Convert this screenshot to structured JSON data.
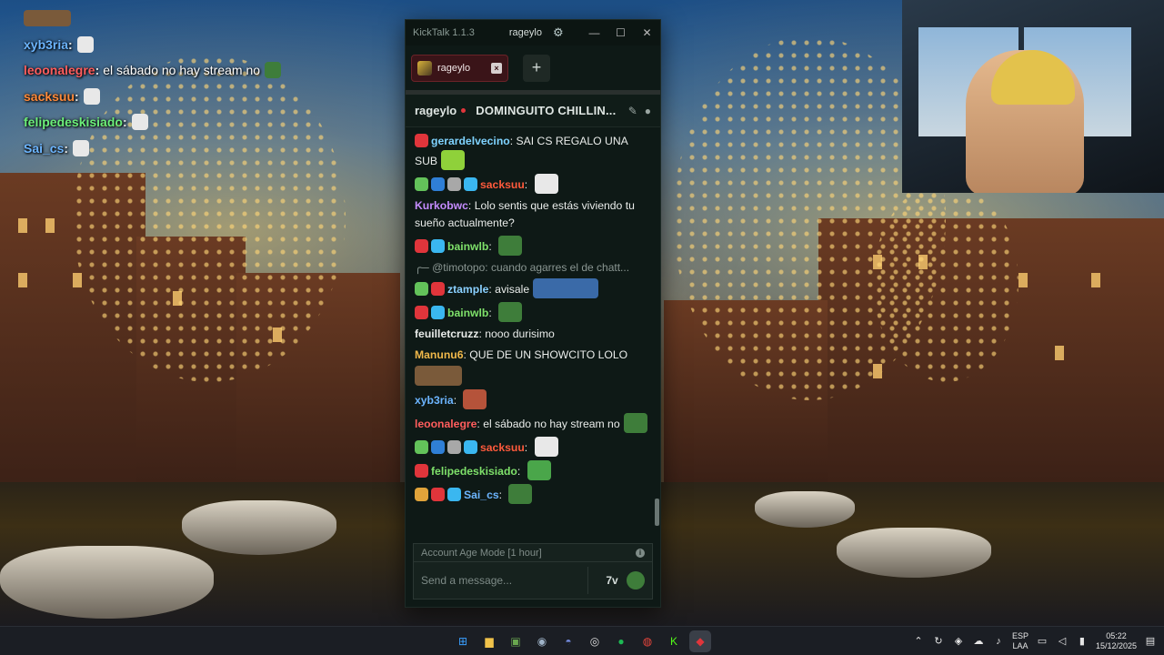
{
  "overlay_chat": [
    {
      "user": "xyb3ria",
      "sep": ":",
      "message": "",
      "color": "#6cb5ff"
    },
    {
      "user": "leoonalegre",
      "sep": ":",
      "message": "el sábado no hay stream no",
      "color": "#ff5d5d"
    },
    {
      "user": "sacksuu",
      "sep": ":",
      "message": "",
      "color": "#ff8a3a"
    },
    {
      "user": "felipedeskisiado",
      "sep": ":",
      "message": "",
      "color": "#6cf07a"
    },
    {
      "user": "Sai_cs",
      "sep": ":",
      "message": "",
      "color": "#6cb5ff"
    }
  ],
  "kicktalk": {
    "app_title": "KickTalk 1.1.3",
    "account": "rageylo",
    "gear_icon": "gear-icon",
    "tab": {
      "label": "rageylo"
    },
    "add_tab_label": "+",
    "channel": {
      "name": "rageylo",
      "stream_title": "DOMINGUITO CHILLIN...",
      "icons": [
        "pin-icon",
        "user-icon"
      ]
    },
    "messages": [
      {
        "user": "gerardelvecino",
        "color": "#7fd3ff",
        "text": "SAI CS REGALO UNA SUB",
        "badges": [
          "#e0353b"
        ],
        "emote": "#8fd13a"
      },
      {
        "user": "sacksuu",
        "color": "#ff5a3c",
        "text": "",
        "badges": [
          "#63c25a",
          "#2f7fd6",
          "#a8a8a8",
          "#3ab7f0"
        ],
        "emote": "#e8e8e8"
      },
      {
        "user": "Kurkobwc",
        "color": "#c58cff",
        "text": "Lolo sentis que estás viviendo tu sueño actualmente?",
        "badges": [],
        "emote": ""
      },
      {
        "user": "bainwlb",
        "color": "#7ee06a",
        "text": "",
        "badges": [
          "#e0353b",
          "#3ab7f0"
        ],
        "emote": "#3e7d3a"
      },
      {
        "reply": "@timotopo: cuando agarres el de chatt..."
      },
      {
        "user": "ztample",
        "color": "#8ad0ff",
        "text": "avisale",
        "badges": [
          "#63c25a",
          "#e0353b"
        ],
        "emote": "#3a6aa8"
      },
      {
        "user": "bainwlb",
        "color": "#7ee06a",
        "text": "",
        "badges": [
          "#e0353b",
          "#3ab7f0"
        ],
        "emote": "#3e7d3a"
      },
      {
        "user": "feuilletcruzz",
        "color": "#e9ecea",
        "text": "nooo durisimo",
        "badges": [],
        "emote": ""
      },
      {
        "user": "Manunu6",
        "color": "#f0b84a",
        "text": "QUE DE UN SHOWCITO LOLO",
        "badges": [],
        "emote": "#7a5a3a"
      },
      {
        "user": "xyb3ria",
        "color": "#6cb5ff",
        "text": "",
        "badges": [],
        "emote": "#b5533a"
      },
      {
        "user": "leoonalegre",
        "color": "#ff5d5d",
        "text": "el sábado no hay stream no",
        "badges": [],
        "emote": "#3e7d3a"
      },
      {
        "user": "sacksuu",
        "color": "#ff5a3c",
        "text": "",
        "badges": [
          "#63c25a",
          "#2f7fd6",
          "#a8a8a8",
          "#3ab7f0"
        ],
        "emote": "#e8e8e8"
      },
      {
        "user": "felipedeskisiado",
        "color": "#7ee06a",
        "text": "",
        "badges": [
          "#e0353b"
        ],
        "emote": "#4aa64a"
      },
      {
        "user": "Sai_cs",
        "color": "#6cb5ff",
        "text": "",
        "badges": [
          "#e0a33a",
          "#e0353b",
          "#3ab7f0"
        ],
        "emote": "#3e7d3a"
      }
    ],
    "account_age_mode": "Account Age Mode [1 hour]",
    "input_placeholder": "Send a message...",
    "input_icons": [
      "7tv-icon",
      "emote-picker-icon"
    ],
    "seventv_label": "7v"
  },
  "taskbar": {
    "apps": [
      {
        "name": "windows-start-icon",
        "glyph": "⊞",
        "color": "#3aa0ff"
      },
      {
        "name": "file-explorer-icon",
        "glyph": "▆",
        "color": "#f0c24a"
      },
      {
        "name": "minecraft-icon",
        "glyph": "▣",
        "color": "#6aa84f"
      },
      {
        "name": "steam-icon",
        "glyph": "◉",
        "color": "#9fb3c8"
      },
      {
        "name": "discord-icon",
        "glyph": "◓",
        "color": "#7289da"
      },
      {
        "name": "obs-icon",
        "glyph": "◎",
        "color": "#dddddd"
      },
      {
        "name": "spotify-icon",
        "glyph": "●",
        "color": "#1db954"
      },
      {
        "name": "chrome-icon",
        "glyph": "◍",
        "color": "#e8453c"
      },
      {
        "name": "kick-icon",
        "glyph": "K",
        "color": "#53fc18"
      },
      {
        "name": "kicktalk-icon",
        "glyph": "◆",
        "color": "#e0353b"
      }
    ],
    "language": [
      "ESP",
      "LAA"
    ],
    "time": "05:22",
    "date": "15/12/2025"
  }
}
